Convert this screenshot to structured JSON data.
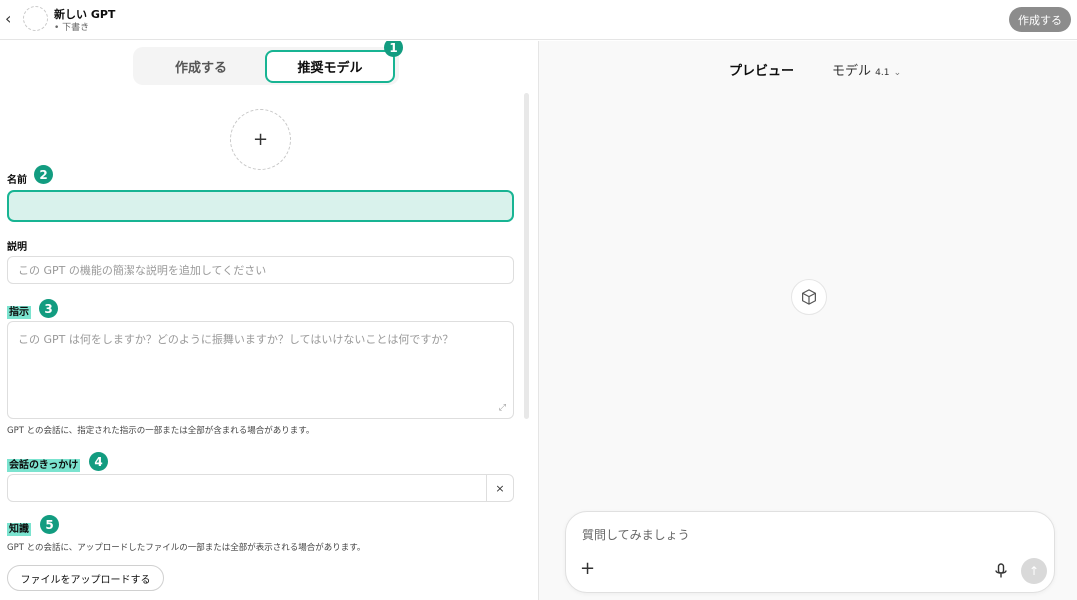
{
  "header": {
    "back": "‹",
    "title": "新しい GPT",
    "status": "• 下書き",
    "create_button": "作成する"
  },
  "tabs": {
    "create": "作成する",
    "recommended": "推奨モデル"
  },
  "badges": [
    "1",
    "2",
    "3",
    "4",
    "5"
  ],
  "image_upload": {
    "symbol": "+"
  },
  "form": {
    "name_label": "名前",
    "name_value": "",
    "description_label": "説明",
    "description_placeholder": "この GPT の機能の簡潔な説明を追加してください",
    "instructions_label": "指示",
    "instructions_placeholder": "この GPT は何をしますか？どのように振舞いますか？してはいけないことは何ですか？",
    "instructions_hint": "GPT との会話に、指定された指示の一部または全部が含まれる場合があります。",
    "starters_label": "会話のきっかけ",
    "starter_remove": "×",
    "knowledge_label": "知識",
    "knowledge_hint": "GPT との会話に、アップロードしたファイルの一部または全部が表示される場合があります。",
    "upload_button": "ファイルをアップロードする"
  },
  "preview": {
    "title": "プレビュー",
    "model_label": "モデル",
    "model_version": "4.1",
    "composer_placeholder": "質問してみましょう",
    "composer_plus": "+"
  },
  "colors": {
    "accent": "#18b493",
    "badge": "#129c80",
    "highlight": "#7be3cf",
    "name_field_fill": "#d9f2ec"
  }
}
